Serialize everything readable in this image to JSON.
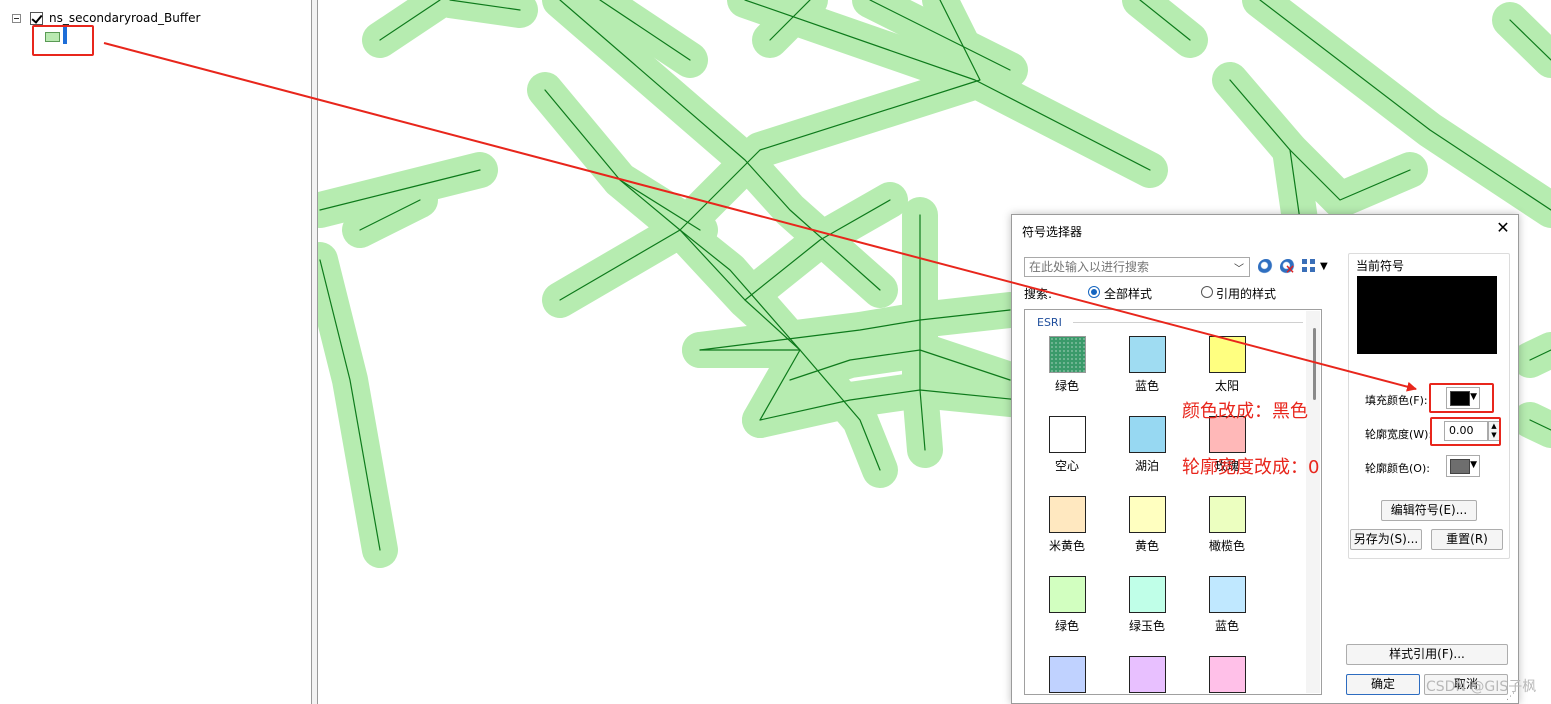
{
  "toc": {
    "layer_name": "ns_secondaryroad_Buffer",
    "layer_checked": true,
    "symbol_color": "#b9e9b1"
  },
  "map": {
    "buffer_fill": "#b6ecb0",
    "road_line": "#0d7a1b"
  },
  "dialog": {
    "title": "符号选择器",
    "close": "✕",
    "search_placeholder": "在此处输入以进行搜索",
    "search_label": "搜索:",
    "radio_all": "全部样式",
    "radio_referenced": "引用的样式",
    "group_name": "ESRI",
    "symbols": [
      {
        "label": "绿色",
        "color": "#3a9a6a"
      },
      {
        "label": "蓝色",
        "color": "#9fdcf2"
      },
      {
        "label": "太阳",
        "color": "#ffff80"
      },
      {
        "label": "空心",
        "color": "#ffffff"
      },
      {
        "label": "湖泊",
        "color": "#97d8f2"
      },
      {
        "label": "玫瑰",
        "color": "#ffb8b8"
      },
      {
        "label": "米黄色",
        "color": "#ffe8c0"
      },
      {
        "label": "黄色",
        "color": "#ffffc0"
      },
      {
        "label": "橄榄色",
        "color": "#ecffc0"
      },
      {
        "label": "绿色",
        "color": "#d2ffc0"
      },
      {
        "label": "绿玉色",
        "color": "#c0ffe8"
      },
      {
        "label": "蓝色",
        "color": "#c0e8ff"
      },
      {
        "label": "",
        "color": "#c0d2ff"
      },
      {
        "label": "",
        "color": "#e8c0ff"
      },
      {
        "label": "",
        "color": "#ffc0e8"
      }
    ],
    "current_symbol_label": "当前符号",
    "current_symbol_color": "#000000",
    "fill_color_label": "填充颜色(F):",
    "fill_color": "#000000",
    "outline_width_label": "轮廓宽度(W):",
    "outline_width_value": "0.00",
    "outline_color_label": "轮廓颜色(O):",
    "outline_color": "#6e6e6e",
    "edit_symbol_button": "编辑符号(E)...",
    "save_as_button": "另存为(S)...",
    "reset_button": "重置(R)",
    "style_ref_button": "样式引用(F)...",
    "ok_button": "确定",
    "cancel_button": "取消"
  },
  "annotations": {
    "note_color": "颜色改成：黑色",
    "note_width": "轮廓宽度改成：0",
    "accent": "#e8261c"
  },
  "watermark": "CSDN @GIS子枫"
}
